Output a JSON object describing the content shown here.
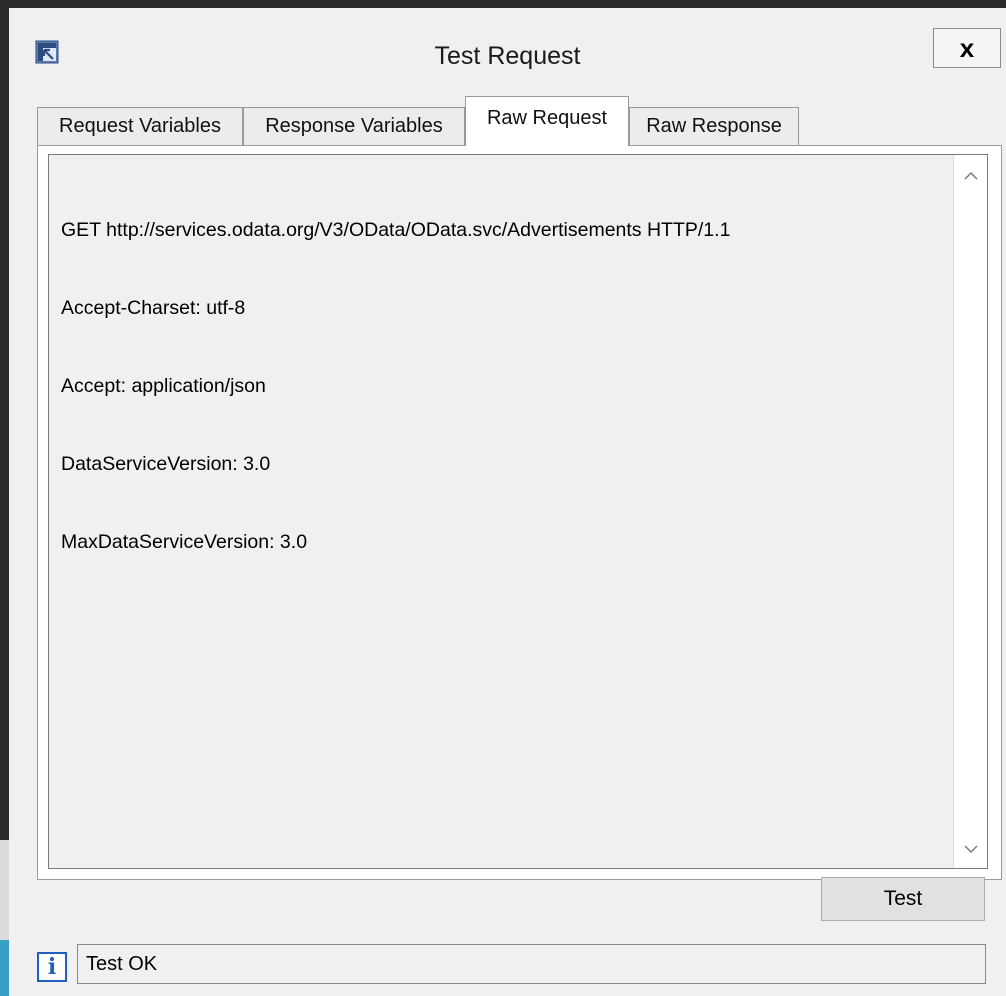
{
  "window": {
    "title": "Test Request",
    "close_label": "x"
  },
  "tabs": [
    {
      "label": "Request Variables",
      "active": false
    },
    {
      "label": "Response Variables",
      "active": false
    },
    {
      "label": "Raw Request",
      "active": true
    },
    {
      "label": "Raw Response",
      "active": false
    }
  ],
  "raw_request": {
    "lines": [
      "GET http://services.odata.org/V3/OData/OData.svc/Advertisements HTTP/1.1",
      "Accept-Charset: utf-8",
      "Accept: application/json",
      "DataServiceVersion: 3.0",
      "MaxDataServiceVersion: 3.0"
    ]
  },
  "scrollbar": {
    "up_icon": "chevron-up-icon",
    "down_icon": "chevron-down-icon"
  },
  "buttons": {
    "test_label": "Test"
  },
  "status": {
    "icon": "info-icon",
    "text": "Test OK"
  },
  "colors": {
    "window_bg": "#f0f0f0",
    "info_blue": "#1f5fbf",
    "outer_dark": "#2b2b2b",
    "outer_teal": "#3a9fc4"
  }
}
